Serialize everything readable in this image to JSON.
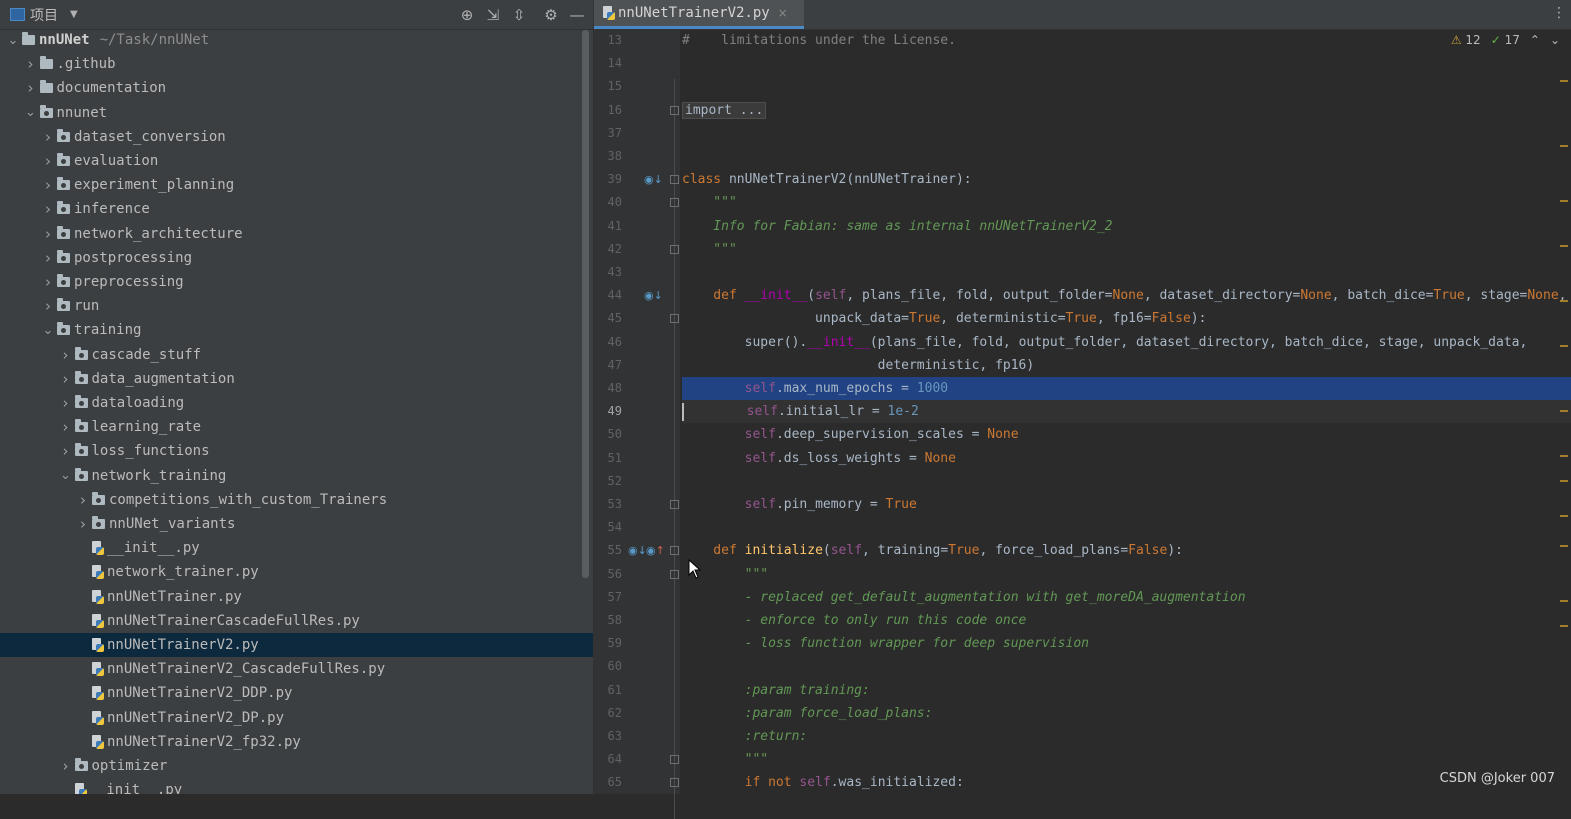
{
  "project_panel": {
    "title": "项目",
    "tools": [
      "locate-icon",
      "expand-all-icon",
      "collapse-all-icon",
      "gear-icon",
      "hide-icon"
    ]
  },
  "tree": [
    {
      "label": "nnUNet",
      "path": "~/Task/nnUNet",
      "kind": "root",
      "depth": 0,
      "expanded": true
    },
    {
      "label": ".github",
      "kind": "folder",
      "depth": 1,
      "expanded": false
    },
    {
      "label": "documentation",
      "kind": "folder",
      "depth": 1,
      "expanded": false
    },
    {
      "label": "nnunet",
      "kind": "package",
      "depth": 1,
      "expanded": true
    },
    {
      "label": "dataset_conversion",
      "kind": "package",
      "depth": 2,
      "expanded": false
    },
    {
      "label": "evaluation",
      "kind": "package",
      "depth": 2,
      "expanded": false
    },
    {
      "label": "experiment_planning",
      "kind": "package",
      "depth": 2,
      "expanded": false
    },
    {
      "label": "inference",
      "kind": "package",
      "depth": 2,
      "expanded": false
    },
    {
      "label": "network_architecture",
      "kind": "package",
      "depth": 2,
      "expanded": false
    },
    {
      "label": "postprocessing",
      "kind": "package",
      "depth": 2,
      "expanded": false
    },
    {
      "label": "preprocessing",
      "kind": "package",
      "depth": 2,
      "expanded": false
    },
    {
      "label": "run",
      "kind": "package",
      "depth": 2,
      "expanded": false
    },
    {
      "label": "training",
      "kind": "package",
      "depth": 2,
      "expanded": true
    },
    {
      "label": "cascade_stuff",
      "kind": "package",
      "depth": 3,
      "expanded": false
    },
    {
      "label": "data_augmentation",
      "kind": "package",
      "depth": 3,
      "expanded": false
    },
    {
      "label": "dataloading",
      "kind": "package",
      "depth": 3,
      "expanded": false
    },
    {
      "label": "learning_rate",
      "kind": "package",
      "depth": 3,
      "expanded": false
    },
    {
      "label": "loss_functions",
      "kind": "package",
      "depth": 3,
      "expanded": false
    },
    {
      "label": "network_training",
      "kind": "package",
      "depth": 3,
      "expanded": true
    },
    {
      "label": "competitions_with_custom_Trainers",
      "kind": "package",
      "depth": 4,
      "expanded": false
    },
    {
      "label": "nnUNet_variants",
      "kind": "package",
      "depth": 4,
      "expanded": false
    },
    {
      "label": "__init__.py",
      "kind": "file",
      "depth": 4
    },
    {
      "label": "network_trainer.py",
      "kind": "file",
      "depth": 4
    },
    {
      "label": "nnUNetTrainer.py",
      "kind": "file",
      "depth": 4
    },
    {
      "label": "nnUNetTrainerCascadeFullRes.py",
      "kind": "file",
      "depth": 4
    },
    {
      "label": "nnUNetTrainerV2.py",
      "kind": "file",
      "depth": 4,
      "selected": true
    },
    {
      "label": "nnUNetTrainerV2_CascadeFullRes.py",
      "kind": "file",
      "depth": 4
    },
    {
      "label": "nnUNetTrainerV2_DDP.py",
      "kind": "file",
      "depth": 4
    },
    {
      "label": "nnUNetTrainerV2_DP.py",
      "kind": "file",
      "depth": 4
    },
    {
      "label": "nnUNetTrainerV2_fp32.py",
      "kind": "file",
      "depth": 4
    },
    {
      "label": "optimizer",
      "kind": "package",
      "depth": 3,
      "expanded": false
    },
    {
      "label": "__init__.py",
      "kind": "file",
      "depth": 3
    }
  ],
  "editor": {
    "tab_title": "nnUNetTrainerV2.py",
    "warnings": "12",
    "weak_warnings": "17",
    "current_line": "49",
    "lines": [
      {
        "n": "13",
        "code": [
          {
            "t": "#    limitations under the License.",
            "c": "cmt"
          }
        ]
      },
      {
        "n": "14",
        "code": []
      },
      {
        "n": "15",
        "code": []
      },
      {
        "n": "16",
        "code": [
          {
            "t": "import ...",
            "c": "fold-ph"
          }
        ]
      },
      {
        "n": "37",
        "code": []
      },
      {
        "n": "38",
        "code": []
      },
      {
        "n": "39",
        "code": [
          {
            "t": "class ",
            "c": "kw"
          },
          {
            "t": "nnUNetTrainerV2(nnUNetTrainer):",
            "c": ""
          }
        ]
      },
      {
        "n": "40",
        "code": [
          {
            "t": "    \"\"\"",
            "c": "doc"
          }
        ]
      },
      {
        "n": "41",
        "code": [
          {
            "t": "    Info for Fabian: same as internal nnUNetTrainerV2_2",
            "c": "doc"
          }
        ]
      },
      {
        "n": "42",
        "code": [
          {
            "t": "    \"\"\"",
            "c": "doc"
          }
        ]
      },
      {
        "n": "43",
        "code": []
      },
      {
        "n": "44",
        "code": [
          {
            "t": "    def ",
            "c": "kw"
          },
          {
            "t": "__init__",
            "c": "dunder"
          },
          {
            "t": "(",
            "c": ""
          },
          {
            "t": "self",
            "c": "selfkw"
          },
          {
            "t": ", plans_file, fold, output_folder=",
            "c": ""
          },
          {
            "t": "None",
            "c": "kw"
          },
          {
            "t": ", dataset_directory=",
            "c": ""
          },
          {
            "t": "None",
            "c": "kw"
          },
          {
            "t": ", batch_dice=",
            "c": ""
          },
          {
            "t": "True",
            "c": "kw"
          },
          {
            "t": ", stage=",
            "c": ""
          },
          {
            "t": "None",
            "c": "kw"
          },
          {
            "t": ",",
            "c": ""
          }
        ]
      },
      {
        "n": "45",
        "code": [
          {
            "t": "                 unpack_data=",
            "c": ""
          },
          {
            "t": "True",
            "c": "kw"
          },
          {
            "t": ", deterministic=",
            "c": ""
          },
          {
            "t": "True",
            "c": "kw"
          },
          {
            "t": ", fp16=",
            "c": ""
          },
          {
            "t": "False",
            "c": "kw"
          },
          {
            "t": "):",
            "c": ""
          }
        ]
      },
      {
        "n": "46",
        "code": [
          {
            "t": "        super().",
            "c": ""
          },
          {
            "t": "__init__",
            "c": "dunder"
          },
          {
            "t": "(plans_file, fold, output_folder, dataset_directory, batch_dice, stage, unpack_data,",
            "c": ""
          }
        ]
      },
      {
        "n": "47",
        "code": [
          {
            "t": "                         deterministic, fp16)",
            "c": ""
          }
        ]
      },
      {
        "n": "48",
        "code": [
          {
            "t": "        ",
            "c": ""
          },
          {
            "t": "self",
            "c": "selfkw"
          },
          {
            "t": ".max_num_epochs = ",
            "c": ""
          },
          {
            "t": "1000",
            "c": "num"
          }
        ],
        "selected": true
      },
      {
        "n": "49",
        "code": [
          {
            "t": "        ",
            "c": ""
          },
          {
            "t": "self",
            "c": "selfkw"
          },
          {
            "t": ".initial_lr = ",
            "c": ""
          },
          {
            "t": "1e-2",
            "c": "num"
          }
        ],
        "current": true
      },
      {
        "n": "50",
        "code": [
          {
            "t": "        ",
            "c": ""
          },
          {
            "t": "self",
            "c": "selfkw"
          },
          {
            "t": ".deep_supervision_scales = ",
            "c": ""
          },
          {
            "t": "None",
            "c": "kw"
          }
        ]
      },
      {
        "n": "51",
        "code": [
          {
            "t": "        ",
            "c": ""
          },
          {
            "t": "self",
            "c": "selfkw"
          },
          {
            "t": ".ds_loss_weights = ",
            "c": ""
          },
          {
            "t": "None",
            "c": "kw"
          }
        ]
      },
      {
        "n": "52",
        "code": []
      },
      {
        "n": "53",
        "code": [
          {
            "t": "        ",
            "c": ""
          },
          {
            "t": "self",
            "c": "selfkw"
          },
          {
            "t": ".pin_memory = ",
            "c": ""
          },
          {
            "t": "True",
            "c": "kw"
          }
        ]
      },
      {
        "n": "54",
        "code": []
      },
      {
        "n": "55",
        "code": [
          {
            "t": "    def ",
            "c": "kw"
          },
          {
            "t": "initialize",
            "c": "fn"
          },
          {
            "t": "(",
            "c": ""
          },
          {
            "t": "self",
            "c": "selfkw"
          },
          {
            "t": ", training=",
            "c": ""
          },
          {
            "t": "True",
            "c": "kw"
          },
          {
            "t": ", force_load_plans=",
            "c": ""
          },
          {
            "t": "False",
            "c": "kw"
          },
          {
            "t": "):",
            "c": ""
          }
        ]
      },
      {
        "n": "56",
        "code": [
          {
            "t": "        \"\"\"",
            "c": "doc"
          }
        ]
      },
      {
        "n": "57",
        "code": [
          {
            "t": "        - replaced get_default_augmentation with get_moreDA_augmentation",
            "c": "doc"
          }
        ]
      },
      {
        "n": "58",
        "code": [
          {
            "t": "        - enforce to only run this code once",
            "c": "doc"
          }
        ]
      },
      {
        "n": "59",
        "code": [
          {
            "t": "        - loss function wrapper for deep supervision",
            "c": "doc"
          }
        ]
      },
      {
        "n": "60",
        "code": []
      },
      {
        "n": "61",
        "code": [
          {
            "t": "        :param training:",
            "c": "doc"
          }
        ]
      },
      {
        "n": "62",
        "code": [
          {
            "t": "        :param force_load_plans:",
            "c": "doc"
          }
        ]
      },
      {
        "n": "63",
        "code": [
          {
            "t": "        :return:",
            "c": "doc"
          }
        ]
      },
      {
        "n": "64",
        "code": [
          {
            "t": "        \"\"\"",
            "c": "doc"
          }
        ]
      },
      {
        "n": "65",
        "code": [
          {
            "t": "        ",
            "c": ""
          },
          {
            "t": "if not ",
            "c": "kw"
          },
          {
            "t": "self",
            "c": "selfkw"
          },
          {
            "t": ".was_initialized:",
            "c": ""
          }
        ]
      }
    ]
  },
  "watermark": "CSDN @Joker 007"
}
